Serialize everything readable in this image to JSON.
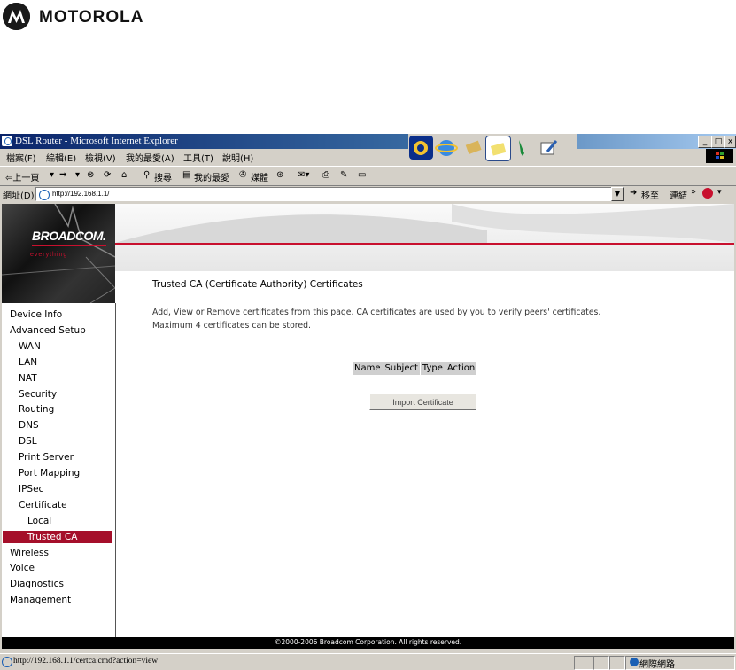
{
  "header": {
    "brand": "MOTOROLA"
  },
  "window": {
    "title": "DSL Router - Microsoft Internet Explorer",
    "controls": {
      "minimize": "_",
      "maximize": "□",
      "close": "x"
    }
  },
  "menubar": {
    "items": [
      "檔案(F)",
      "編輯(E)",
      "檢視(V)",
      "我的最愛(A)",
      "工具(T)",
      "說明(H)"
    ]
  },
  "toolbar": {
    "back": "⇦上一頁",
    "search": "搜尋",
    "favorites": "我的最愛",
    "media": "媒體"
  },
  "address": {
    "label": "網址(D)",
    "url": "http://192.168.1.1/",
    "go": "移至",
    "links": "連結"
  },
  "banner": {
    "logo": "BROADCOM.",
    "tagline": "everything"
  },
  "sidebar": {
    "items": [
      {
        "label": "Device Info",
        "level": 1
      },
      {
        "label": "Advanced Setup",
        "level": 1
      },
      {
        "label": "WAN",
        "level": 2
      },
      {
        "label": "LAN",
        "level": 2
      },
      {
        "label": "NAT",
        "level": 2
      },
      {
        "label": "Security",
        "level": 2
      },
      {
        "label": "Routing",
        "level": 2
      },
      {
        "label": "DNS",
        "level": 2
      },
      {
        "label": "DSL",
        "level": 2
      },
      {
        "label": "Print Server",
        "level": 2
      },
      {
        "label": "Port Mapping",
        "level": 2
      },
      {
        "label": "IPSec",
        "level": 2
      },
      {
        "label": "Certificate",
        "level": 2
      },
      {
        "label": "Local",
        "level": 3
      },
      {
        "label": "Trusted CA",
        "level": 3,
        "selected": true
      },
      {
        "label": "Wireless",
        "level": 1
      },
      {
        "label": "Voice",
        "level": 1
      },
      {
        "label": "Diagnostics",
        "level": 1
      },
      {
        "label": "Management",
        "level": 1
      }
    ]
  },
  "main": {
    "title": "Trusted CA (Certificate Authority) Certificates",
    "description_line1": "Add, View or Remove certificates from this page. CA certificates are used by you to verify peers' certificates.",
    "description_line2": "Maximum 4 certificates can be stored.",
    "table_headers": [
      "Name",
      "Subject",
      "Type",
      "Action"
    ],
    "import_button": "Import Certificate"
  },
  "footer": {
    "copyright": "©2000-2006 Broadcom Corporation. All rights reserved."
  },
  "statusbar": {
    "text": "http://192.168.1.1/certca.cmd?action=view",
    "zone": "網際網路"
  },
  "colors": {
    "accent_red": "#c8102e",
    "sidebar_highlight": "#a50f2a",
    "titlebar": "#0a246a"
  }
}
